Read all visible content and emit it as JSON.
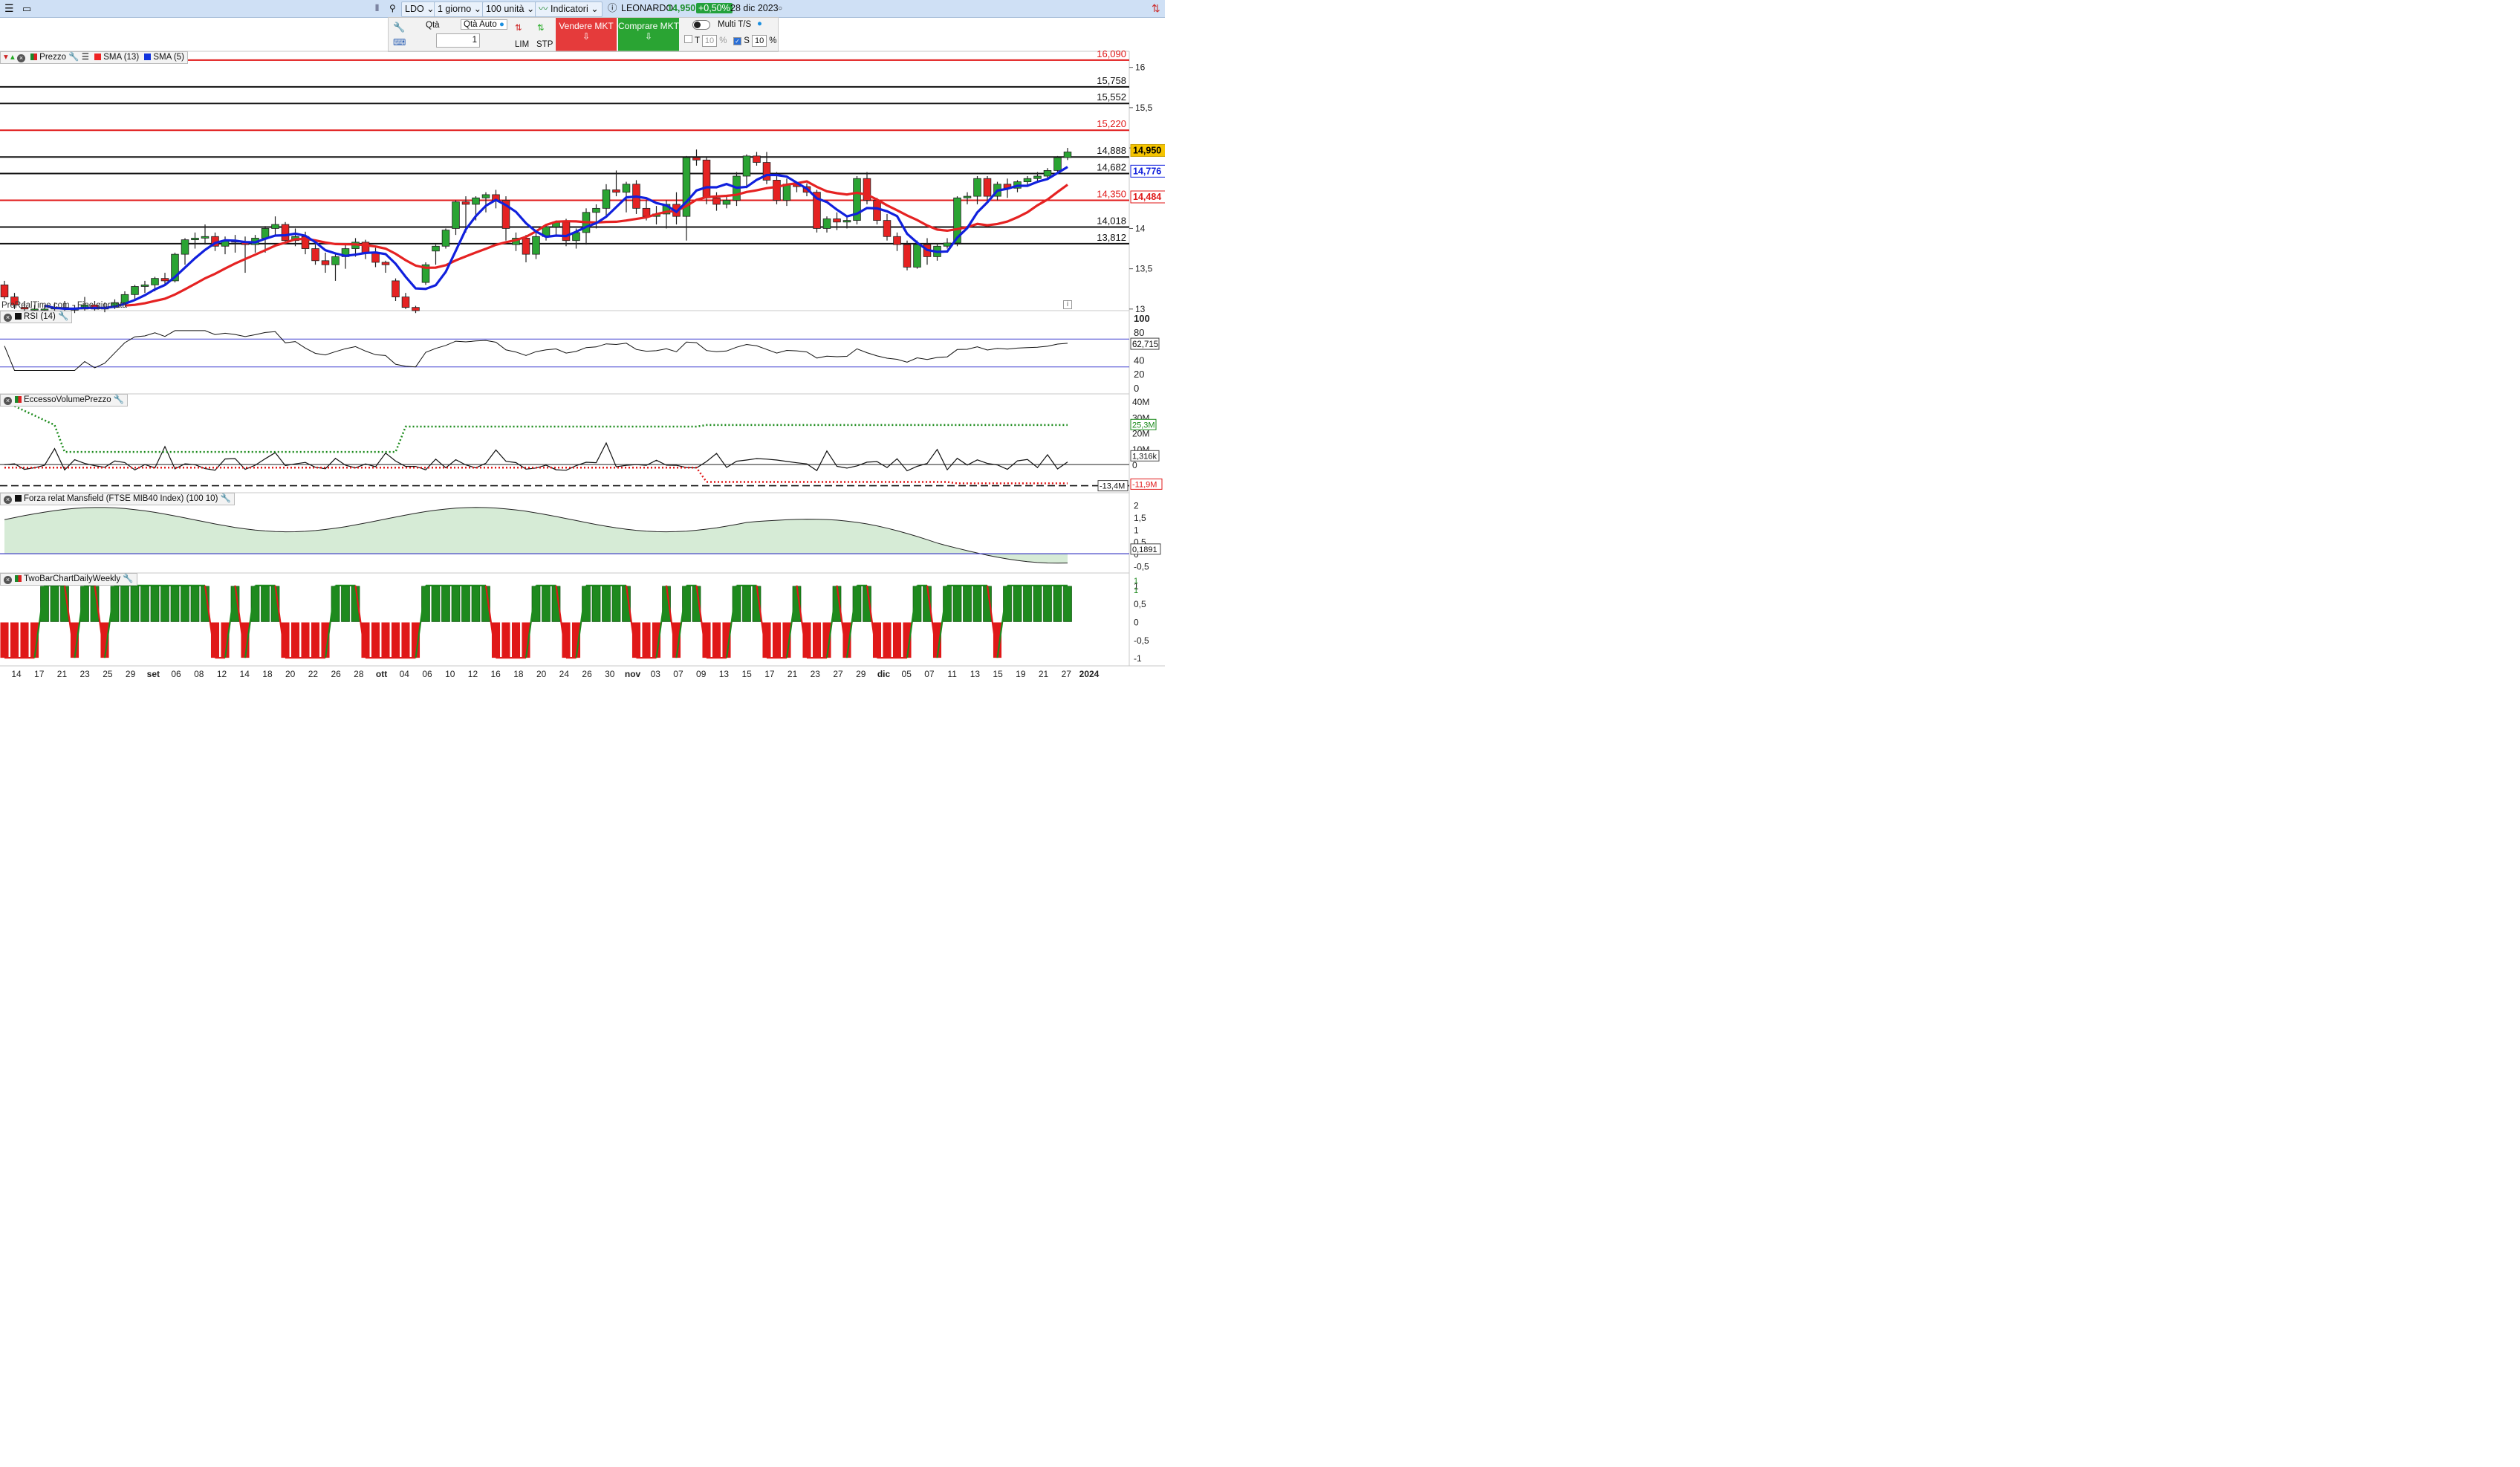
{
  "toolbar": {
    "ticker": "LDO",
    "timeframe": "1 giorno",
    "units": "100 unità",
    "indicators_label": "Indicatori",
    "instrument": "LEONARDO",
    "price": "14,950",
    "change": "+0,50%",
    "date": "28 dic 2023"
  },
  "order_bar": {
    "qty_label": "Qtà",
    "qty_auto_label": "Qtà Auto",
    "qty_value": "1",
    "lim_label": "LIM",
    "stp_label": "STP",
    "sell_label": "Vendere MKT",
    "buy_label": "Comprare MKT",
    "multi_label": "Multi T/S",
    "t_label": "T",
    "t_value": "10",
    "pct1": "%",
    "s_label": "S",
    "s_value": "10",
    "pct2": "%"
  },
  "panels": {
    "price_title": "Prezzo",
    "sma13": "SMA (13)",
    "sma5": "SMA (5)",
    "watermark": "ProRealTime.com - Fine giornata",
    "rsi_title": "RSI (14)",
    "evp_title": "EccessoVolumePrezzo",
    "mansfield_title": "Forza relat Mansfield (FTSE MIB40 Index) (100 10)",
    "twobar_title": "TwoBarChartDailyWeekly"
  },
  "colors": {
    "up": "#2aa433",
    "down": "#e52222",
    "sma5": "#1020dd",
    "sma13": "#e52222",
    "hline_red": "#e01818",
    "hline_black": "#111111"
  },
  "chart_data": [
    {
      "type": "candlestick",
      "name": "Prezzo",
      "categories": [
        "14",
        "17",
        "21",
        "23",
        "25",
        "29",
        "set",
        "06",
        "08",
        "12",
        "14",
        "18",
        "20",
        "22",
        "26",
        "28",
        "ott",
        "04",
        "06",
        "10",
        "12",
        "16",
        "18",
        "20",
        "24",
        "26",
        "30",
        "nov",
        "03",
        "07",
        "09",
        "13",
        "15",
        "17",
        "21",
        "23",
        "27",
        "29",
        "dic",
        "05",
        "07",
        "11",
        "13",
        "15",
        "19",
        "21",
        "27",
        "2024"
      ],
      "y_ticks": [
        "16",
        "15,5",
        "15",
        "14",
        "13,5",
        "13"
      ],
      "ylim": [
        12.98,
        16.2
      ],
      "hlines": [
        {
          "value": 16.09,
          "label": "16,090",
          "color": "red"
        },
        {
          "value": 15.758,
          "label": "15,758",
          "color": "black"
        },
        {
          "value": 15.552,
          "label": "15,552",
          "color": "black"
        },
        {
          "value": 15.22,
          "label": "15,220",
          "color": "red"
        },
        {
          "value": 14.888,
          "label": "14,888",
          "color": "black"
        },
        {
          "value": 14.682,
          "label": "14,682",
          "color": "black"
        },
        {
          "value": 14.35,
          "label": "14,350",
          "color": "red"
        },
        {
          "value": 14.018,
          "label": "14,018",
          "color": "black"
        },
        {
          "value": 13.812,
          "label": "13,812",
          "color": "black"
        }
      ],
      "last_price_label": "14,950",
      "sma5_label": "14,776",
      "sma13_label": "14,484",
      "ohlc": [
        [
          13.3,
          13.35,
          13.12,
          13.15
        ],
        [
          13.15,
          13.2,
          13.0,
          13.05
        ],
        [
          13.02,
          13.1,
          12.95,
          13.0
        ],
        [
          13.0,
          13.05,
          12.95,
          13.0
        ],
        [
          13.0,
          13.05,
          12.95,
          13.0
        ],
        [
          13.0,
          13.08,
          12.95,
          13.02
        ],
        [
          13.02,
          13.1,
          12.95,
          13.0
        ],
        [
          13.0,
          13.05,
          12.95,
          13.0
        ],
        [
          13.0,
          13.15,
          12.98,
          13.05
        ],
        [
          13.05,
          13.1,
          12.98,
          13.0
        ],
        [
          13.0,
          13.08,
          12.96,
          13.02
        ],
        [
          13.02,
          13.12,
          13.0,
          13.08
        ],
        [
          13.08,
          13.22,
          13.05,
          13.18
        ],
        [
          13.18,
          13.3,
          13.1,
          13.28
        ],
        [
          13.28,
          13.35,
          13.2,
          13.3
        ],
        [
          13.3,
          13.4,
          13.22,
          13.38
        ],
        [
          13.38,
          13.45,
          13.3,
          13.35
        ],
        [
          13.35,
          13.7,
          13.33,
          13.68
        ],
        [
          13.68,
          13.88,
          13.55,
          13.86
        ],
        [
          13.86,
          13.95,
          13.75,
          13.88
        ],
        [
          13.88,
          14.05,
          13.8,
          13.9
        ],
        [
          13.9,
          13.95,
          13.72,
          13.78
        ],
        [
          13.78,
          13.9,
          13.68,
          13.85
        ],
        [
          13.85,
          13.92,
          13.7,
          13.83
        ],
        [
          13.83,
          13.9,
          13.45,
          13.8
        ],
        [
          13.8,
          13.92,
          13.7,
          13.88
        ],
        [
          13.88,
          14.03,
          13.7,
          14.0
        ],
        [
          14.0,
          14.15,
          13.9,
          14.05
        ],
        [
          14.05,
          14.08,
          13.82,
          13.85
        ],
        [
          13.85,
          14.0,
          13.78,
          13.9
        ],
        [
          13.9,
          13.96,
          13.68,
          13.75
        ],
        [
          13.75,
          13.8,
          13.55,
          13.6
        ],
        [
          13.6,
          13.7,
          13.45,
          13.55
        ],
        [
          13.55,
          13.68,
          13.35,
          13.65
        ],
        [
          13.65,
          13.82,
          13.5,
          13.75
        ],
        [
          13.75,
          13.88,
          13.65,
          13.83
        ],
        [
          13.83,
          13.86,
          13.62,
          13.7
        ],
        [
          13.7,
          13.76,
          13.52,
          13.58
        ],
        [
          13.58,
          13.6,
          13.45,
          13.55
        ],
        [
          13.35,
          13.38,
          13.1,
          13.15
        ],
        [
          13.15,
          13.2,
          13.0,
          13.02
        ],
        [
          13.02,
          13.04,
          12.95,
          12.98
        ],
        [
          13.33,
          13.58,
          13.3,
          13.55
        ],
        [
          13.72,
          13.8,
          13.55,
          13.78
        ],
        [
          13.78,
          14.0,
          13.75,
          13.98
        ],
        [
          14.0,
          14.35,
          13.92,
          14.33
        ],
        [
          14.33,
          14.4,
          13.95,
          14.3
        ],
        [
          14.3,
          14.4,
          14.1,
          14.38
        ],
        [
          14.38,
          14.45,
          14.2,
          14.42
        ],
        [
          14.42,
          14.48,
          14.25,
          14.35
        ],
        [
          14.35,
          14.4,
          13.85,
          14.0
        ],
        [
          13.8,
          13.95,
          13.72,
          13.88
        ],
        [
          13.88,
          13.92,
          13.58,
          13.68
        ],
        [
          13.68,
          13.95,
          13.62,
          13.9
        ],
        [
          13.9,
          14.05,
          13.85,
          14.02
        ],
        [
          14.02,
          14.1,
          13.9,
          14.08
        ],
        [
          14.08,
          14.12,
          13.78,
          13.85
        ],
        [
          13.85,
          14.0,
          13.75,
          13.95
        ],
        [
          13.95,
          14.25,
          13.8,
          14.2
        ],
        [
          14.2,
          14.3,
          14.0,
          14.25
        ],
        [
          14.25,
          14.55,
          14.15,
          14.48
        ],
        [
          14.48,
          14.72,
          14.4,
          14.45
        ],
        [
          14.45,
          14.58,
          14.2,
          14.55
        ],
        [
          14.55,
          14.6,
          14.18,
          14.25
        ],
        [
          14.25,
          14.35,
          14.1,
          14.15
        ],
        [
          14.15,
          14.28,
          14.05,
          14.18
        ],
        [
          14.18,
          14.35,
          14.0,
          14.3
        ],
        [
          14.3,
          14.45,
          14.05,
          14.15
        ],
        [
          14.15,
          14.9,
          13.85,
          14.88
        ],
        [
          14.88,
          14.98,
          14.78,
          14.85
        ],
        [
          14.85,
          14.88,
          14.3,
          14.38
        ],
        [
          14.38,
          14.45,
          14.22,
          14.3
        ],
        [
          14.3,
          14.4,
          14.25,
          14.35
        ],
        [
          14.35,
          14.7,
          14.28,
          14.65
        ],
        [
          14.65,
          14.92,
          14.5,
          14.9
        ],
        [
          14.9,
          14.95,
          14.78,
          14.82
        ],
        [
          14.82,
          14.95,
          14.55,
          14.6
        ],
        [
          14.6,
          14.7,
          14.3,
          14.35
        ],
        [
          14.35,
          14.62,
          14.28,
          14.55
        ],
        [
          14.55,
          14.58,
          14.45,
          14.52
        ],
        [
          14.52,
          14.56,
          14.4,
          14.45
        ],
        [
          14.45,
          14.48,
          13.95,
          14.0
        ],
        [
          14.0,
          14.15,
          13.95,
          14.12
        ],
        [
          14.12,
          14.2,
          13.98,
          14.08
        ],
        [
          14.08,
          14.15,
          14.0,
          14.1
        ],
        [
          14.1,
          14.65,
          14.05,
          14.62
        ],
        [
          14.62,
          14.7,
          14.3,
          14.35
        ],
        [
          14.35,
          14.38,
          14.05,
          14.1
        ],
        [
          14.1,
          14.18,
          13.85,
          13.9
        ],
        [
          13.9,
          13.95,
          13.72,
          13.8
        ],
        [
          13.8,
          13.85,
          13.48,
          13.52
        ],
        [
          13.52,
          13.85,
          13.5,
          13.8
        ],
        [
          13.8,
          13.88,
          13.55,
          13.65
        ],
        [
          13.65,
          13.82,
          13.6,
          13.78
        ],
        [
          13.78,
          13.88,
          13.75,
          13.82
        ],
        [
          13.82,
          14.4,
          13.78,
          14.38
        ],
        [
          14.38,
          14.45,
          14.3,
          14.4
        ],
        [
          14.4,
          14.65,
          14.3,
          14.62
        ],
        [
          14.62,
          14.65,
          14.35,
          14.4
        ],
        [
          14.4,
          14.58,
          14.35,
          14.55
        ],
        [
          14.55,
          14.62,
          14.38,
          14.5
        ],
        [
          14.5,
          14.6,
          14.45,
          14.58
        ],
        [
          14.58,
          14.65,
          14.52,
          14.62
        ],
        [
          14.62,
          14.7,
          14.58,
          14.65
        ],
        [
          14.65,
          14.75,
          14.6,
          14.72
        ],
        [
          14.72,
          14.9,
          14.7,
          14.88
        ],
        [
          14.88,
          15.0,
          14.85,
          14.95
        ]
      ]
    },
    {
      "type": "line",
      "name": "RSI (14)",
      "ylim": [
        0,
        100
      ],
      "y_ticks": [
        "100",
        "80",
        "60",
        "40",
        "20",
        "0"
      ],
      "last_label": "62,715",
      "levels": [
        70,
        30
      ]
    },
    {
      "type": "line",
      "name": "EccessoVolumePrezzo",
      "y_ticks": [
        "40M",
        "30M",
        "20M",
        "10M",
        "0"
      ],
      "labels": [
        "25,3M",
        "1,316k",
        "-13,4M",
        "-11,9M"
      ]
    },
    {
      "type": "area",
      "name": "Forza relat Mansfield (FTSE MIB40 Index) (100 10)",
      "y_ticks": [
        "2",
        "1,5",
        "1",
        "0,5",
        "0",
        "-0,5"
      ],
      "last_label": "0,1891"
    },
    {
      "type": "bar",
      "name": "TwoBarChartDailyWeekly",
      "y_ticks": [
        "1",
        "0,5",
        "0",
        "-0,5",
        "-1"
      ],
      "labels": [
        "1",
        "1"
      ]
    }
  ]
}
